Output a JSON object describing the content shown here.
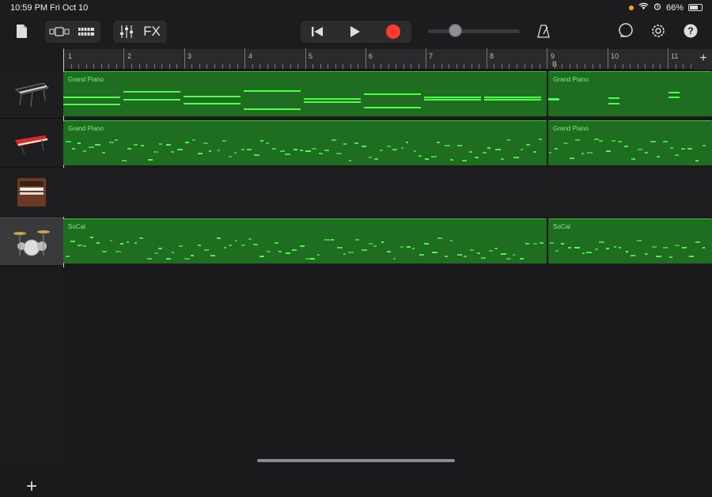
{
  "status": {
    "time": "10:59 PM",
    "date": "Fri Oct 10",
    "battery": "66%"
  },
  "toolbar": {
    "fx_label": "FX"
  },
  "ruler": {
    "bars": [
      "1",
      "2",
      "3",
      "4",
      "5",
      "6",
      "7",
      "8",
      "9",
      "10",
      "11"
    ],
    "section_b": "B"
  },
  "tracks": [
    {
      "instrument": "grand-piano",
      "regions": [
        "Grand Piano",
        "Grand Piano"
      ]
    },
    {
      "instrument": "synth-keyboard",
      "regions": [
        "Grand Piano",
        "Grand Piano"
      ]
    },
    {
      "instrument": "organ",
      "regions": []
    },
    {
      "instrument": "drum-kit",
      "regions": [
        "SoCal",
        "SoCal"
      ]
    }
  ],
  "colors": {
    "region": "#1f6d20",
    "note": "#4cff4c",
    "record": "#ff3b30"
  }
}
